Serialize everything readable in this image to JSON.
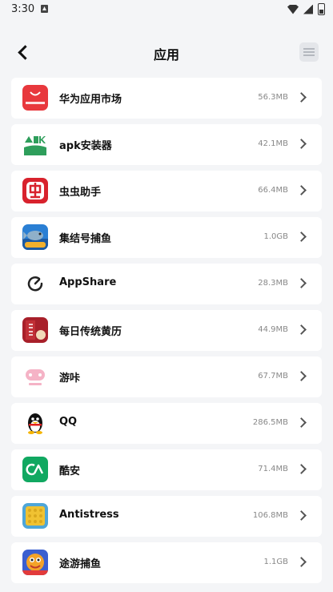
{
  "status_bar": {
    "time": "3:30"
  },
  "header": {
    "title": "应用"
  },
  "apps": [
    {
      "name": "华为应用市场",
      "size": "56.3MB",
      "icon": "huawei-appgallery-icon"
    },
    {
      "name": "apk安装器",
      "size": "42.1MB",
      "icon": "apk-installer-icon"
    },
    {
      "name": "虫虫助手",
      "size": "66.4MB",
      "icon": "chongchong-icon"
    },
    {
      "name": "集结号捕鱼",
      "size": "1.0GB",
      "icon": "fishing-game-icon"
    },
    {
      "name": "AppShare",
      "size": "28.3MB",
      "icon": "appshare-icon"
    },
    {
      "name": "每日传统黄历",
      "size": "44.9MB",
      "icon": "almanac-icon"
    },
    {
      "name": "游咔",
      "size": "67.7MB",
      "icon": "youka-icon"
    },
    {
      "name": "QQ",
      "size": "286.5MB",
      "icon": "qq-penguin-icon"
    },
    {
      "name": "酷安",
      "size": "71.4MB",
      "icon": "coolapk-icon"
    },
    {
      "name": "Antistress",
      "size": "106.8MB",
      "icon": "antistress-icon"
    },
    {
      "name": "途游捕鱼",
      "size": "1.1GB",
      "icon": "tuyou-fishing-icon"
    }
  ]
}
